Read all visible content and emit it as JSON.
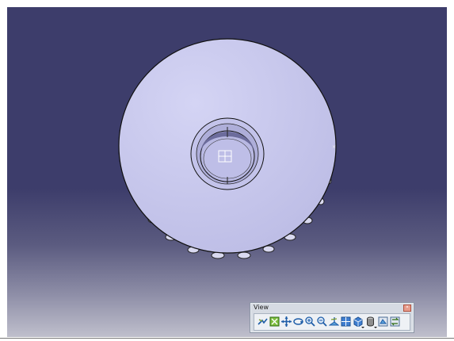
{
  "toolbar": {
    "title": "View",
    "close_glyph": "×",
    "tools": [
      {
        "icon": "fly-mode-icon"
      },
      {
        "icon": "fit-all-in-icon"
      },
      {
        "icon": "pan-icon"
      },
      {
        "icon": "rotate-icon"
      },
      {
        "icon": "zoom-in-icon"
      },
      {
        "icon": "zoom-out-icon"
      },
      {
        "icon": "normal-view-icon"
      },
      {
        "icon": "multi-view-icon"
      },
      {
        "icon": "iso-view-icon"
      },
      {
        "icon": "shading-icon"
      },
      {
        "icon": "hide-show-icon"
      },
      {
        "icon": "swap-visible-space-icon"
      }
    ]
  },
  "colors": {
    "background_top": "#3d3d6b",
    "background_bottom": "#bfbfcc",
    "part_face": "#c9c9ee",
    "part_edge": "#1a1a1a"
  }
}
